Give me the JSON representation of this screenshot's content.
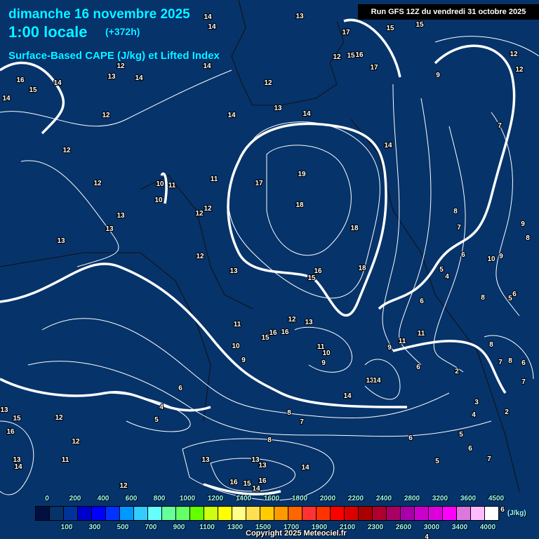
{
  "header": {
    "date": "dimanche 16 novembre 2025",
    "time": "1:00 locale",
    "lead": "(+372h)",
    "parameter": "Surface-Based CAPE (J/kg) et Lifted Index",
    "run": "Run GFS 12Z du vendredi 31 octobre 2025"
  },
  "legend": {
    "unit": "(J/kg)",
    "top_ticks": [
      "0",
      "200",
      "400",
      "600",
      "800",
      "1000",
      "1200",
      "1400",
      "1600",
      "1800",
      "2000",
      "2200",
      "2400",
      "2800",
      "3200",
      "3600",
      "4500"
    ],
    "bottom_ticks": [
      "100",
      "300",
      "500",
      "700",
      "900",
      "1100",
      "1300",
      "1500",
      "1700",
      "1900",
      "2100",
      "2300",
      "2600",
      "3000",
      "3400",
      "4000"
    ],
    "colors": [
      "#021040",
      "#06336a",
      "#003399",
      "#0000cc",
      "#0000ff",
      "#0033ff",
      "#0099ff",
      "#33ccff",
      "#66ffff",
      "#66ff99",
      "#66ff66",
      "#66ff00",
      "#ccff11",
      "#ffff00",
      "#ffff88",
      "#ffe050",
      "#ffcc00",
      "#ff9900",
      "#ff6600",
      "#ff3333",
      "#ff3300",
      "#ff0000",
      "#dd0000",
      "#aa0000",
      "#b00030",
      "#aa0066",
      "#aa00aa",
      "#cc00cc",
      "#dd00dd",
      "#ff00ff",
      "#dd77dd",
      "#ffbbff",
      "#ffffff"
    ]
  },
  "copyright": "Copyright 2025 Meteociel.fr",
  "contour_labels": [
    "14",
    "14",
    "13",
    "17",
    "15",
    "15",
    "12",
    "15",
    "16",
    "17",
    "12",
    "12",
    "9",
    "14",
    "12",
    "12",
    "13",
    "14",
    "16",
    "15",
    "14",
    "14",
    "12",
    "14",
    "13",
    "14",
    "7",
    "14",
    "12",
    "12",
    "10",
    "11",
    "11",
    "19",
    "17",
    "10",
    "12",
    "12",
    "18",
    "13",
    "13",
    "8",
    "9",
    "7",
    "18",
    "8",
    "13",
    "6",
    "10",
    "9",
    "12",
    "18",
    "5",
    "4",
    "13",
    "16",
    "15",
    "8",
    "6",
    "5",
    "6",
    "12",
    "13",
    "11",
    "16",
    "16",
    "15",
    "11",
    "11",
    "9",
    "11",
    "10",
    "10",
    "8",
    "9",
    "9",
    "7",
    "8",
    "6",
    "6",
    "2",
    "13",
    "14",
    "7",
    "6",
    "14",
    "3",
    "4",
    "2",
    "13",
    "15",
    "12",
    "8",
    "5",
    "7",
    "4",
    "16",
    "6",
    "5",
    "8",
    "12",
    "6",
    "13",
    "14",
    "13",
    "11",
    "13",
    "13",
    "14",
    "7",
    "5",
    "16",
    "15",
    "16",
    "12",
    "14",
    "6",
    "4"
  ]
}
